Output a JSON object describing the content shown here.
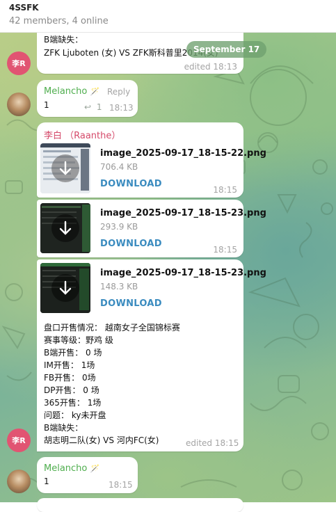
{
  "header": {
    "title": "4SSFK",
    "subtitle": "42 members, 4 online"
  },
  "date_pill": "September 17",
  "msg1": {
    "lines": [
      "B端缺失：",
      "ZFK Ljuboten (女) VS ZFK斯科普里2014(女)"
    ],
    "time": "edited 18:13",
    "avatar_initials": "李R"
  },
  "msg2": {
    "sender": "Melancho",
    "sender_emoji": "🪄",
    "reply_label": "Reply",
    "text": "1",
    "reply_count": "1",
    "time": "18:13"
  },
  "msg3": {
    "sender": "李白 （Raanthe）",
    "files": [
      {
        "name": "image_2025-09-17_18-15-22.png",
        "size": "706.4 KB",
        "action": "DOWNLOAD",
        "time": "18:15"
      },
      {
        "name": "image_2025-09-17_18-15-23.png",
        "size": "293.9 KB",
        "action": "DOWNLOAD",
        "time": "18:15"
      },
      {
        "name": "image_2025-09-17_18-15-23.png",
        "size": "148.3 KB",
        "action": "DOWNLOAD"
      }
    ],
    "lines": [
      "盘口开售情况：   越南女子全国锦标赛",
      "赛事等级：野鸡  级",
      "B端开售：   0  场",
      "IM开售：    1场",
      "FB开售：    0场",
      "DP开售：   0  场",
      "365开售：    1场",
      "问题：    ky未开盘",
      "B端缺失：",
      "胡志明二队(女) VS 河内FC(女)"
    ],
    "time": "edited 18:15",
    "avatar_initials": "李R"
  },
  "msg4": {
    "sender": "Melancho",
    "sender_emoji": "🪄",
    "text": "1",
    "time": "18:15"
  },
  "colors": {
    "sender_green": "#4fae4e",
    "sender_red": "#d54a6a",
    "link_blue": "#3a8bbf",
    "avatar_red": "#e15472"
  }
}
